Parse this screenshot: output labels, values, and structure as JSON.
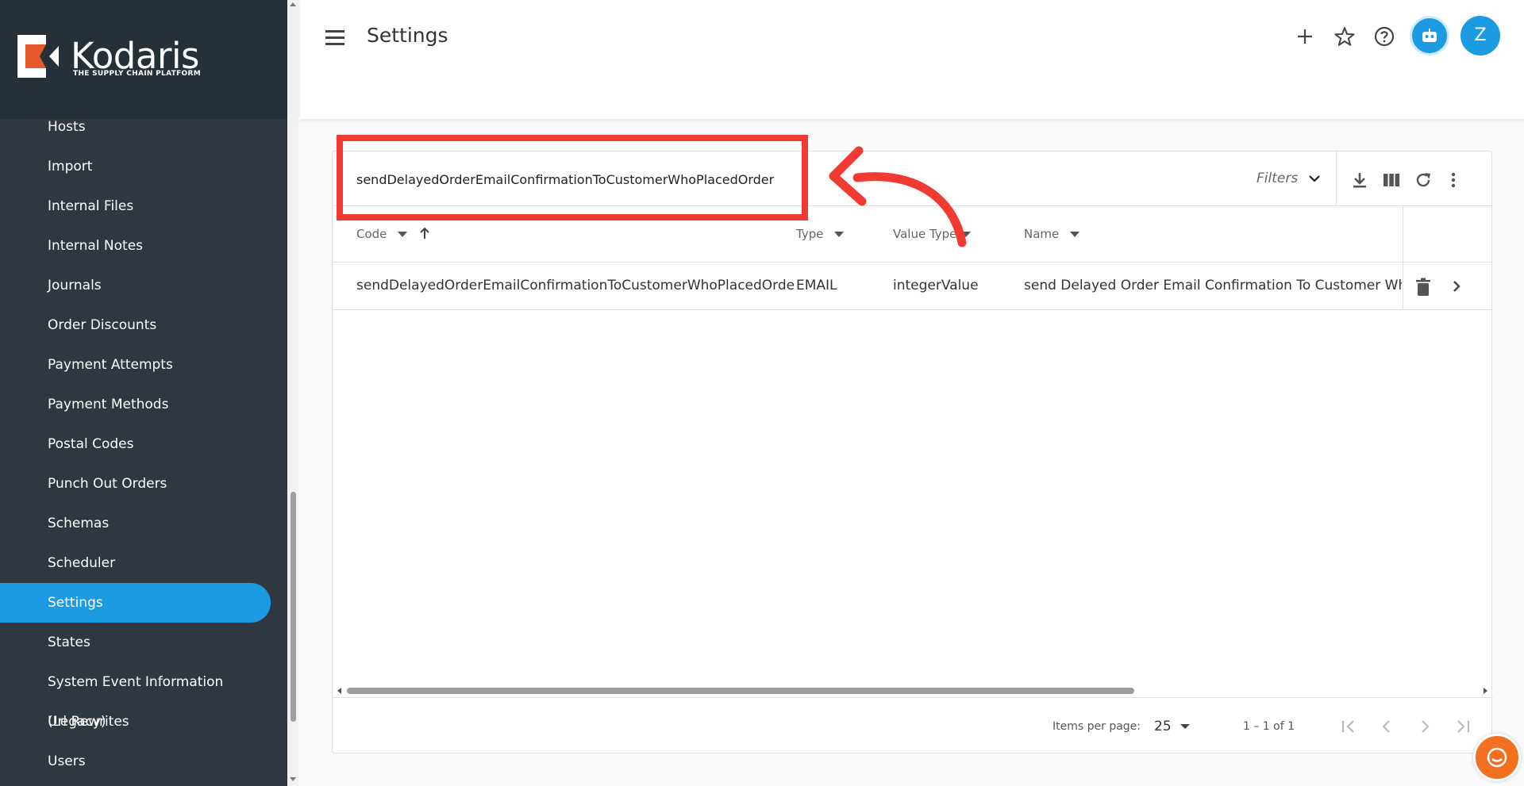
{
  "brand": {
    "name": "Kodaris",
    "tagline": "THE SUPPLY CHAIN PLATFORM"
  },
  "sidebar": {
    "items": [
      {
        "label": "Hosts"
      },
      {
        "label": "Import"
      },
      {
        "label": "Internal Files"
      },
      {
        "label": "Internal Notes"
      },
      {
        "label": "Journals"
      },
      {
        "label": "Order Discounts"
      },
      {
        "label": "Payment Attempts"
      },
      {
        "label": "Payment Methods"
      },
      {
        "label": "Postal Codes"
      },
      {
        "label": "Punch Out Orders"
      },
      {
        "label": "Schemas"
      },
      {
        "label": "Scheduler"
      },
      {
        "label": "Settings"
      },
      {
        "label": "States"
      },
      {
        "label": "System Event Information (Legacy)"
      },
      {
        "label": "Url Rewrites"
      },
      {
        "label": "Users"
      }
    ],
    "active": "Settings"
  },
  "header": {
    "title": "Settings",
    "avatar_initial": "Z",
    "icons": [
      "add-icon",
      "star-icon",
      "help-icon",
      "robot-icon"
    ]
  },
  "table": {
    "search_value": "sendDelayedOrderEmailConfirmationToCustomerWhoPlacedOrder",
    "filters_label": "Filters",
    "columns": [
      "Code",
      "Type",
      "Value Type",
      "Name"
    ],
    "rows": [
      {
        "code": "sendDelayedOrderEmailConfirmationToCustomerWhoPlacedOrder",
        "type": "EMAIL",
        "value_type": "integerValue",
        "name": "send Delayed Order Email Confirmation To Customer Who P"
      }
    ]
  },
  "paginator": {
    "items_per_page_label": "Items per page:",
    "items_per_page": "25",
    "range": "1 – 1 of 1"
  },
  "colors": {
    "accent": "#1d9be2",
    "sidebar": "#2f3740",
    "annotation": "#f03a32",
    "chat": "#f37021"
  }
}
